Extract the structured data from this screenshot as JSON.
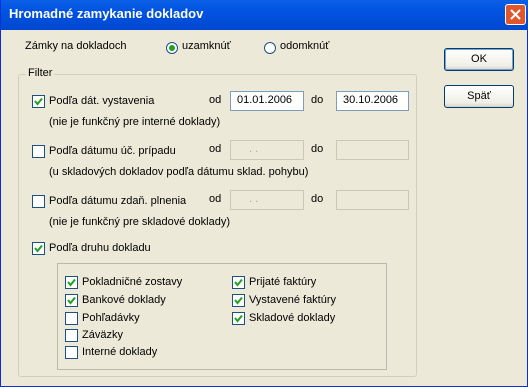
{
  "title": "Hromadné zamykanie dokladov",
  "lock": {
    "label": "Zámky na dokladoch",
    "option_lock": "uzamknúť",
    "option_unlock": "odomknúť",
    "selected": "uzamknúť"
  },
  "filter_label": "Filter",
  "date_issue": {
    "label": "Podľa dát. vystavenia",
    "note": "(nie je funkčný pre interné doklady)",
    "from_label": "od",
    "from": "01.01.2006",
    "to_label": "do",
    "to": "30.10.2006",
    "checked": true
  },
  "date_accounting": {
    "label": "Podľa dátumu úč. prípadu",
    "note": "(u skladových dokladov podľa dátumu sklad. pohybu)",
    "from_label": "od",
    "from": ". .",
    "to_label": "do",
    "to": "",
    "checked": false
  },
  "date_tax": {
    "label": "Podľa dátumu zdaň. plnenia",
    "note": "(nie je funkčný pre skladové doklady)",
    "from_label": "od",
    "from": ". .",
    "to_label": "do",
    "to": "",
    "checked": false
  },
  "doc_type": {
    "label": "Podľa druhu dokladu",
    "checked": true
  },
  "doc_types": [
    {
      "label": "Pokladničné zostavy",
      "checked": true
    },
    {
      "label": "Bankové doklady",
      "checked": true
    },
    {
      "label": "Pohľadávky",
      "checked": false
    },
    {
      "label": "Záväzky",
      "checked": false
    },
    {
      "label": "Interné doklady",
      "checked": false
    },
    {
      "label": "Prijaté faktúry",
      "checked": true
    },
    {
      "label": "Vystavené faktúry",
      "checked": true
    },
    {
      "label": "Skladové doklady",
      "checked": true
    }
  ],
  "buttons": {
    "ok": "OK",
    "back": "Späť"
  }
}
